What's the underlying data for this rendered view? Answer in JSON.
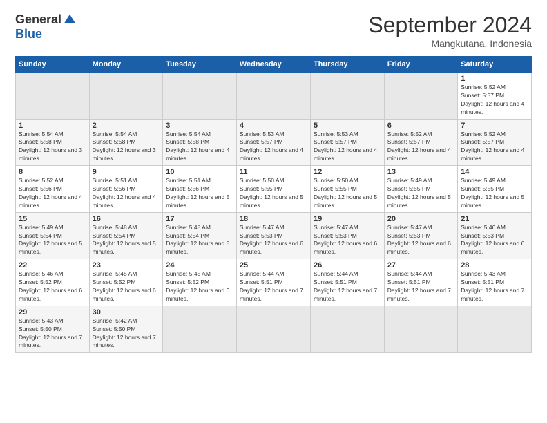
{
  "header": {
    "logo_general": "General",
    "logo_blue": "Blue",
    "month_title": "September 2024",
    "location": "Mangkutana, Indonesia"
  },
  "calendar": {
    "days_of_week": [
      "Sunday",
      "Monday",
      "Tuesday",
      "Wednesday",
      "Thursday",
      "Friday",
      "Saturday"
    ],
    "weeks": [
      [
        {
          "day": "",
          "empty": true
        },
        {
          "day": "",
          "empty": true
        },
        {
          "day": "",
          "empty": true
        },
        {
          "day": "",
          "empty": true
        },
        {
          "day": "",
          "empty": true
        },
        {
          "day": "",
          "empty": true
        },
        {
          "day": "1",
          "sunrise": "5:52 AM",
          "sunset": "5:57 PM",
          "daylight": "12 hours and 4 minutes."
        }
      ],
      [
        {
          "day": "1",
          "sunrise": "5:54 AM",
          "sunset": "5:58 PM",
          "daylight": "12 hours and 3 minutes."
        },
        {
          "day": "2",
          "sunrise": "5:54 AM",
          "sunset": "5:58 PM",
          "daylight": "12 hours and 3 minutes."
        },
        {
          "day": "3",
          "sunrise": "5:54 AM",
          "sunset": "5:58 PM",
          "daylight": "12 hours and 4 minutes."
        },
        {
          "day": "4",
          "sunrise": "5:53 AM",
          "sunset": "5:57 PM",
          "daylight": "12 hours and 4 minutes."
        },
        {
          "day": "5",
          "sunrise": "5:53 AM",
          "sunset": "5:57 PM",
          "daylight": "12 hours and 4 minutes."
        },
        {
          "day": "6",
          "sunrise": "5:52 AM",
          "sunset": "5:57 PM",
          "daylight": "12 hours and 4 minutes."
        },
        {
          "day": "7",
          "sunrise": "5:52 AM",
          "sunset": "5:57 PM",
          "daylight": "12 hours and 4 minutes."
        }
      ],
      [
        {
          "day": "8",
          "sunrise": "5:52 AM",
          "sunset": "5:56 PM",
          "daylight": "12 hours and 4 minutes."
        },
        {
          "day": "9",
          "sunrise": "5:51 AM",
          "sunset": "5:56 PM",
          "daylight": "12 hours and 4 minutes."
        },
        {
          "day": "10",
          "sunrise": "5:51 AM",
          "sunset": "5:56 PM",
          "daylight": "12 hours and 5 minutes."
        },
        {
          "day": "11",
          "sunrise": "5:50 AM",
          "sunset": "5:55 PM",
          "daylight": "12 hours and 5 minutes."
        },
        {
          "day": "12",
          "sunrise": "5:50 AM",
          "sunset": "5:55 PM",
          "daylight": "12 hours and 5 minutes."
        },
        {
          "day": "13",
          "sunrise": "5:49 AM",
          "sunset": "5:55 PM",
          "daylight": "12 hours and 5 minutes."
        },
        {
          "day": "14",
          "sunrise": "5:49 AM",
          "sunset": "5:55 PM",
          "daylight": "12 hours and 5 minutes."
        }
      ],
      [
        {
          "day": "15",
          "sunrise": "5:49 AM",
          "sunset": "5:54 PM",
          "daylight": "12 hours and 5 minutes."
        },
        {
          "day": "16",
          "sunrise": "5:48 AM",
          "sunset": "5:54 PM",
          "daylight": "12 hours and 5 minutes."
        },
        {
          "day": "17",
          "sunrise": "5:48 AM",
          "sunset": "5:54 PM",
          "daylight": "12 hours and 5 minutes."
        },
        {
          "day": "18",
          "sunrise": "5:47 AM",
          "sunset": "5:53 PM",
          "daylight": "12 hours and 6 minutes."
        },
        {
          "day": "19",
          "sunrise": "5:47 AM",
          "sunset": "5:53 PM",
          "daylight": "12 hours and 6 minutes."
        },
        {
          "day": "20",
          "sunrise": "5:47 AM",
          "sunset": "5:53 PM",
          "daylight": "12 hours and 6 minutes."
        },
        {
          "day": "21",
          "sunrise": "5:46 AM",
          "sunset": "5:53 PM",
          "daylight": "12 hours and 6 minutes."
        }
      ],
      [
        {
          "day": "22",
          "sunrise": "5:46 AM",
          "sunset": "5:52 PM",
          "daylight": "12 hours and 6 minutes."
        },
        {
          "day": "23",
          "sunrise": "5:45 AM",
          "sunset": "5:52 PM",
          "daylight": "12 hours and 6 minutes."
        },
        {
          "day": "24",
          "sunrise": "5:45 AM",
          "sunset": "5:52 PM",
          "daylight": "12 hours and 6 minutes."
        },
        {
          "day": "25",
          "sunrise": "5:44 AM",
          "sunset": "5:51 PM",
          "daylight": "12 hours and 7 minutes."
        },
        {
          "day": "26",
          "sunrise": "5:44 AM",
          "sunset": "5:51 PM",
          "daylight": "12 hours and 7 minutes."
        },
        {
          "day": "27",
          "sunrise": "5:44 AM",
          "sunset": "5:51 PM",
          "daylight": "12 hours and 7 minutes."
        },
        {
          "day": "28",
          "sunrise": "5:43 AM",
          "sunset": "5:51 PM",
          "daylight": "12 hours and 7 minutes."
        }
      ],
      [
        {
          "day": "29",
          "sunrise": "5:43 AM",
          "sunset": "5:50 PM",
          "daylight": "12 hours and 7 minutes."
        },
        {
          "day": "30",
          "sunrise": "5:42 AM",
          "sunset": "5:50 PM",
          "daylight": "12 hours and 7 minutes."
        },
        {
          "day": "",
          "empty": true
        },
        {
          "day": "",
          "empty": true
        },
        {
          "day": "",
          "empty": true
        },
        {
          "day": "",
          "empty": true
        },
        {
          "day": "",
          "empty": true
        }
      ]
    ]
  }
}
